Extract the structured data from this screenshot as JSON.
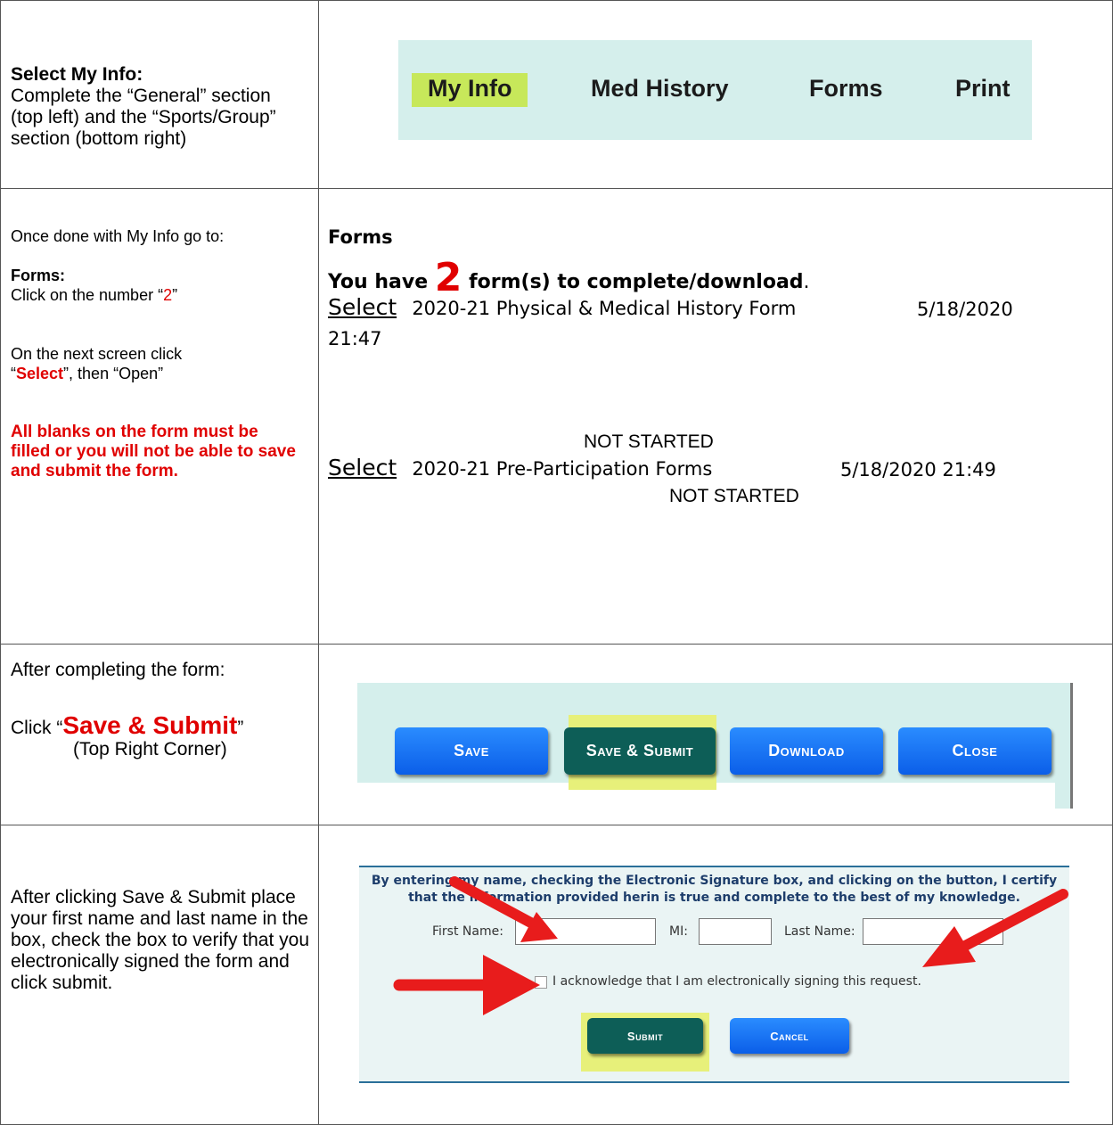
{
  "row1": {
    "left_title": "Select My Info:",
    "left_body": "Complete the “General” section (top left) and the “Sports/Group” section (bottom right)",
    "nav": [
      "My Info",
      "Med History",
      "Forms",
      "Print"
    ]
  },
  "row2": {
    "intro": "Once done with My Info go to:",
    "forms_label": "Forms:",
    "click_prefix": "Click on the number “",
    "click_number": "2",
    "click_suffix": "”",
    "next_prefix": "On the next screen click “",
    "next_select": "Select",
    "next_suffix": "”, then “Open”",
    "warning": "All blanks on the form must be filled or you will not be able to save and submit the form.",
    "forms_title": "Forms",
    "have_prefix": "You have ",
    "have_count": "2",
    "have_suffix": " form(s) to complete/download",
    "have_period": ".",
    "form1": {
      "select": "Select",
      "name": "2020-21 Physical & Medical History Form",
      "date": "5/18/2020",
      "time": "21:47",
      "status": "NOT STARTED"
    },
    "form2": {
      "select": "Select",
      "name": "2020-21 Pre-Participation Forms",
      "datetime": "5/18/2020 21:49",
      "status": "NOT STARTED"
    }
  },
  "row3": {
    "after": "After completing the form:",
    "click_prefix": "Click “",
    "click_action": "Save & Submit",
    "click_suffix": "”",
    "corner": "(Top Right Corner)",
    "buttons": [
      "Save",
      "Save & Submit",
      "Download",
      "Close"
    ]
  },
  "row4": {
    "instruction": "After clicking Save & Submit place your first name and last name in the box, check the box to verify that you electronically signed the form and click submit.",
    "cert_line1": "By entering my name, checking the Electronic Signature box, and clicking on the button, I certify",
    "cert_line2": "that the information provided herin is true and complete to the best of my knowledge.",
    "first_name_label": "First Name:",
    "mi_label": "MI:",
    "last_name_label": "Last Name:",
    "acknowledge": "I acknowledge that I am electronically signing this request.",
    "submit": "Submit",
    "cancel": "Cancel"
  },
  "colors": {
    "red": "#e00000",
    "nav_bg": "#d5efec",
    "highlight": "#c7e85a",
    "teal_button": "#0d5e57",
    "blue_button": "#0b5ee8"
  }
}
